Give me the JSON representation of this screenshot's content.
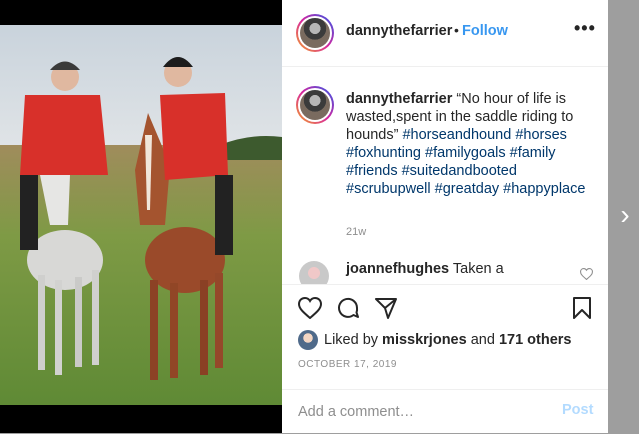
{
  "header": {
    "username": "dannythefarrier",
    "separator": "•",
    "follow_label": "Follow",
    "more_label": "•••"
  },
  "caption": {
    "username": "dannythefarrier",
    "text": "“No hour of life is wasted,spent in the saddle riding to hounds”",
    "hashtags": "#horseandhound #horses #foxhunting #familygoals #family #friends #suitedandbooted #scrubupwell #greatday #happyplace",
    "time_ago": "21w"
  },
  "comment": {
    "username": "joannefhughes",
    "text": "Taken a"
  },
  "actions": {
    "like_icon": "heart-icon",
    "comment_icon": "speech-bubble-icon",
    "share_icon": "paper-plane-icon",
    "save_icon": "bookmark-icon"
  },
  "likes": {
    "prefix": "Liked by",
    "user": "misskrjones",
    "middle": "and",
    "others": "171 others"
  },
  "date": "OCTOBER 17, 2019",
  "comment_box": {
    "placeholder": "Add a comment…",
    "post_label": "Post"
  },
  "navigation": {
    "next_icon": "chevron-right-icon",
    "next_glyph": "›"
  },
  "colors": {
    "accent_link": "#3897f0",
    "hashtag": "#00376b",
    "muted": "#8e8e8e",
    "post_disabled": "#b3dbff"
  }
}
